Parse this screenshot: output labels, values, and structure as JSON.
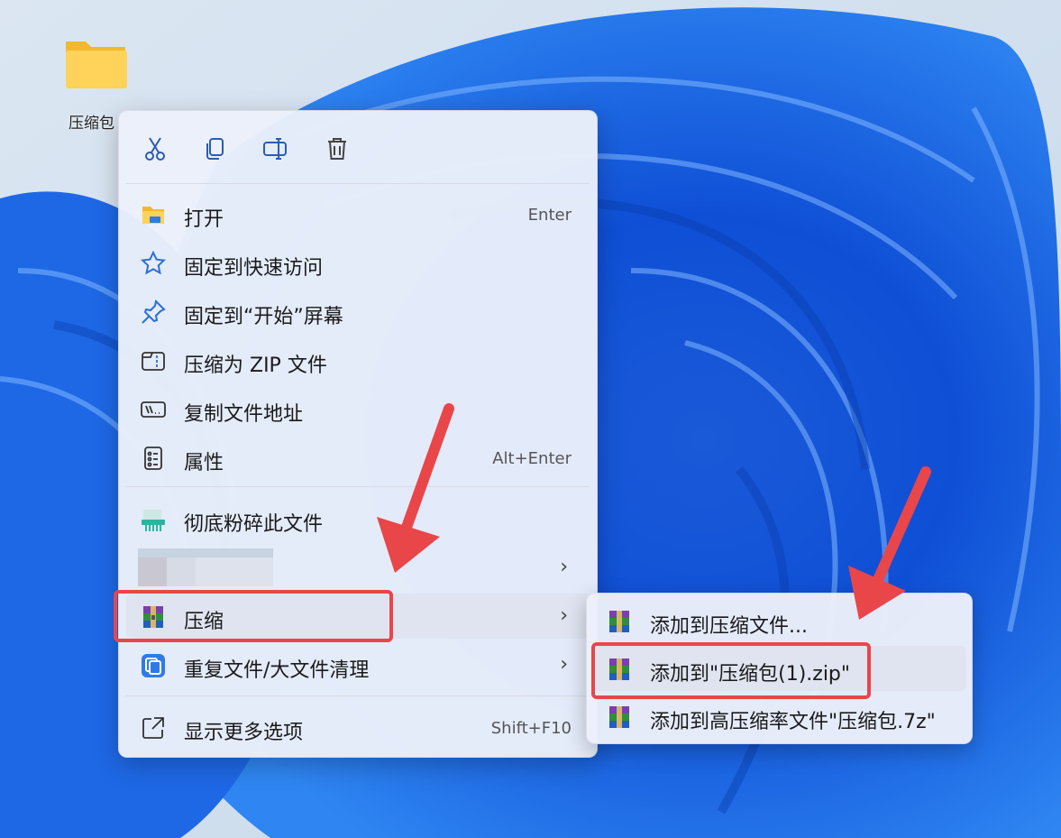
{
  "desktop": {
    "folder_label": "压缩包"
  },
  "toolbar": {
    "buttons": [
      {
        "name": "cut-icon"
      },
      {
        "name": "copy-icon"
      },
      {
        "name": "rename-icon"
      },
      {
        "name": "delete-icon"
      }
    ]
  },
  "menu": {
    "items": [
      {
        "label": "打开",
        "accel": "Enter",
        "icon": "folder-open-icon"
      },
      {
        "label": "固定到快速访问",
        "accel": "",
        "icon": "star-icon"
      },
      {
        "label": "固定到“开始”屏幕",
        "accel": "",
        "icon": "pin-icon"
      },
      {
        "label": "压缩为 ZIP 文件",
        "accel": "",
        "icon": "zip-icon"
      },
      {
        "label": "复制文件地址",
        "accel": "",
        "icon": "path-icon"
      },
      {
        "label": "属性",
        "accel": "Alt+Enter",
        "icon": "properties-icon"
      }
    ],
    "shred": {
      "label": "彻底粉碎此文件",
      "icon": "shredder-icon"
    },
    "compress": {
      "label": "压缩",
      "chevron": "›",
      "icon": "winrar-icon"
    },
    "dedupe": {
      "label": "重复文件/大文件清理",
      "chevron": "›",
      "icon": "dedupe-icon"
    },
    "blurred_chevron": "›",
    "more": {
      "label": "显示更多选项",
      "accel": "Shift+F10",
      "icon": "more-options-icon"
    }
  },
  "submenu": {
    "items": [
      {
        "label": "添加到压缩文件..."
      },
      {
        "label": "添加到\"压缩包(1).zip\""
      },
      {
        "label": "添加到高压缩率文件\"压缩包.7z\""
      }
    ]
  },
  "colors": {
    "highlight": "#e9464a",
    "accent": "#1f6fe0"
  }
}
